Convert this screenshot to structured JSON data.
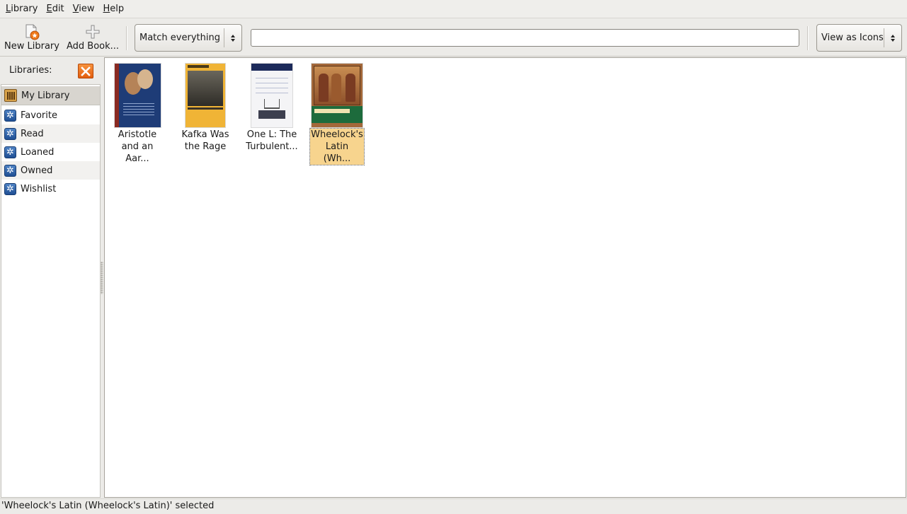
{
  "menubar": {
    "items": [
      {
        "label": "Library",
        "accel": "L",
        "rest": "ibrary"
      },
      {
        "label": "Edit",
        "accel": "E",
        "rest": "dit"
      },
      {
        "label": "View",
        "accel": "V",
        "rest": "iew"
      },
      {
        "label": "Help",
        "accel": "H",
        "rest": "elp"
      }
    ]
  },
  "toolbar": {
    "new_library_label": "New Library",
    "new_library_icon": "new-library-icon",
    "add_book_label": "Add Book...",
    "add_book_icon": "plus-icon",
    "match_combo": {
      "selected": "Match everything"
    },
    "search": {
      "value": "",
      "placeholder": ""
    },
    "view_combo": {
      "selected": "View as Icons"
    }
  },
  "sidebar": {
    "header_label": "Libraries:",
    "close_icon": "close-icon",
    "libraries": [
      {
        "label": "My Library",
        "icon": "library-shelf-icon",
        "selected": true
      },
      {
        "label": "Favorite",
        "icon": "gear-icon"
      },
      {
        "label": "Read",
        "icon": "gear-icon"
      },
      {
        "label": "Loaned",
        "icon": "gear-icon"
      },
      {
        "label": "Owned",
        "icon": "gear-icon"
      },
      {
        "label": "Wishlist",
        "icon": "gear-icon"
      }
    ]
  },
  "books": [
    {
      "title": "Aristotle and an Aar...",
      "cover_color": "#1e3c77"
    },
    {
      "title": "Kafka Was the Rage",
      "cover_color": "#f0b436"
    },
    {
      "title": "One L: The Turbulent...",
      "cover_color": "#f4f4f6"
    },
    {
      "title": "Wheelock's Latin (Wh...",
      "cover_color": "#a3683a",
      "selected": true
    }
  ],
  "colors": {
    "selection_bg": "#f7d48e",
    "close_button": "#e35e0e",
    "library_icon": "#1f4f94"
  },
  "statusbar": {
    "text": "'Wheelock's Latin (Wheelock's Latin)' selected"
  }
}
